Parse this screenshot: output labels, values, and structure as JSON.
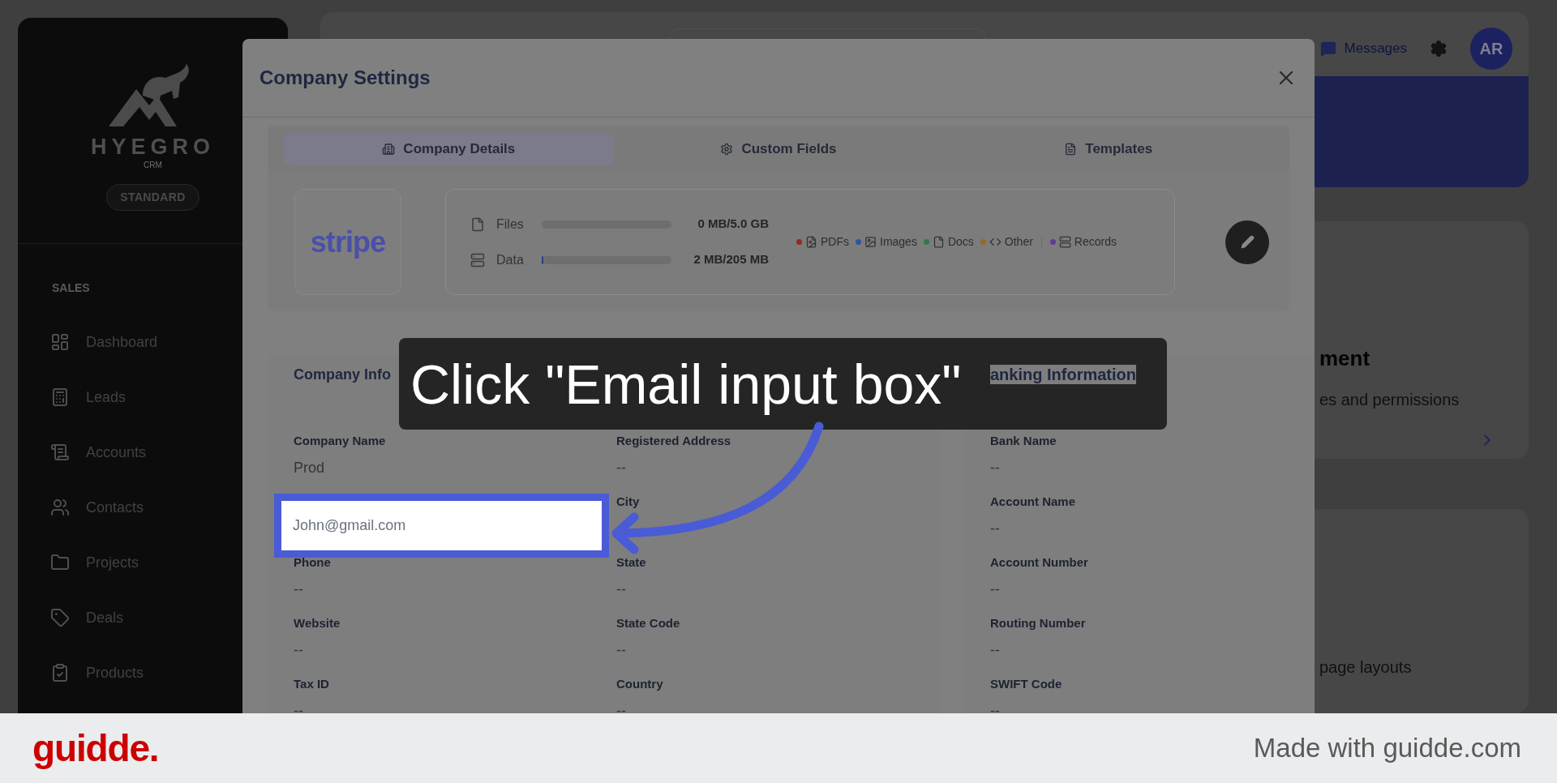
{
  "sidebar": {
    "logo": "HYEGRO",
    "logo_sub": "CRM",
    "plan": "STANDARD",
    "section": "SALES",
    "items": [
      {
        "label": "Dashboard"
      },
      {
        "label": "Leads"
      },
      {
        "label": "Accounts"
      },
      {
        "label": "Contacts"
      },
      {
        "label": "Projects"
      },
      {
        "label": "Deals"
      },
      {
        "label": "Products"
      }
    ]
  },
  "header": {
    "messages": "Messages",
    "avatar": "AR"
  },
  "background_cards": [
    {
      "title": "ment",
      "text": "es and permissions"
    },
    {
      "text": "page layouts"
    }
  ],
  "modal": {
    "title": "Company Settings",
    "tabs": [
      {
        "label": "Company Details",
        "selected": true
      },
      {
        "label": "Custom Fields",
        "selected": false
      },
      {
        "label": "Templates",
        "selected": false
      }
    ],
    "logo": "stripe",
    "storage": [
      {
        "label": "Files",
        "level": 0,
        "reading": "0 MB/5.0 GB"
      },
      {
        "label": "Data",
        "level": 0.01,
        "reading": "2 MB/205 MB"
      }
    ],
    "legend": [
      {
        "label": "PDFs",
        "color": "#8f2a2a"
      },
      {
        "label": "Images",
        "color": "#2f55a0"
      },
      {
        "label": "Docs",
        "color": "#2f7a4c"
      },
      {
        "label": "Other",
        "color": "#9a6820"
      },
      {
        "label": "Records",
        "color": "#5b3d9c"
      }
    ],
    "sections": [
      {
        "title": "Company Info",
        "columns": [
          [
            {
              "kind": "text",
              "label": "Company Name",
              "value": "Prod"
            },
            {
              "kind": "input",
              "value": "John@gmail.com"
            },
            {
              "kind": "text",
              "label": "Phone",
              "value": "--"
            },
            {
              "kind": "text",
              "label": "Website",
              "value": "--"
            },
            {
              "kind": "text",
              "label": "Tax ID",
              "value": "--"
            }
          ],
          [
            {
              "kind": "text",
              "label": "Registered Address",
              "value": "--"
            },
            {
              "kind": "text",
              "label": "City"
            },
            {
              "kind": "text",
              "label": "State",
              "value": "--"
            },
            {
              "kind": "text",
              "label": "State Code",
              "value": "--"
            },
            {
              "kind": "text",
              "label": "Country",
              "value": "--"
            }
          ]
        ]
      },
      {
        "title": "anking Information",
        "columns": [
          [
            {
              "kind": "text",
              "label": "Bank Name",
              "value": "--"
            },
            {
              "kind": "text",
              "label": "Account Name",
              "value": "--"
            },
            {
              "kind": "text",
              "label": "Account Number",
              "value": "--"
            },
            {
              "kind": "text",
              "label": "Routing Number",
              "value": "--"
            },
            {
              "kind": "text",
              "label": "SWIFT Code",
              "value": "--"
            }
          ]
        ]
      }
    ]
  },
  "callout": {
    "text": "Click \"Email input box\""
  },
  "footer": {
    "brand": "guidde.",
    "credit": "Made with guidde.com"
  }
}
